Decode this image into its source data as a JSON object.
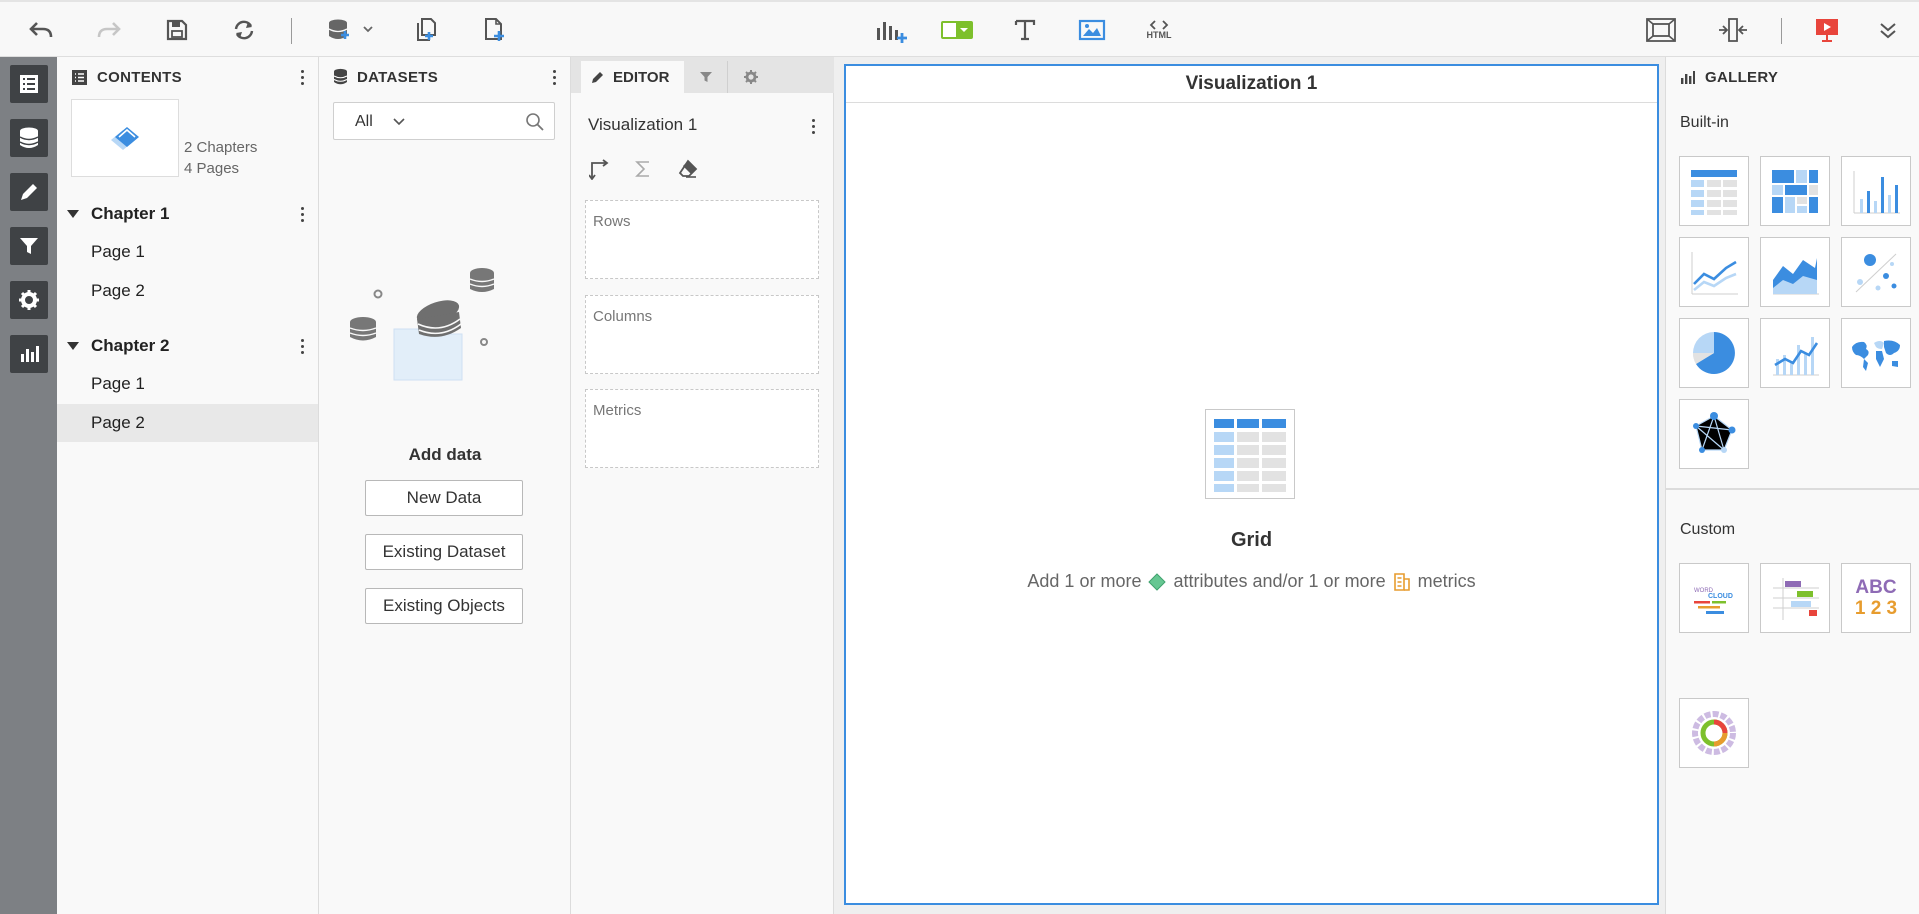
{
  "toolbar": {
    "undo": "undo-icon",
    "redo": "redo-icon",
    "save": "save-icon",
    "refresh": "refresh-icon",
    "add_data": "database-add-icon",
    "duplicate_chapter": "duplicate-page-icon",
    "new_page": "new-page-icon",
    "insert_visualization": "insert-chart-icon",
    "insert_filter": "filter-selector-icon",
    "insert_text": "text-icon",
    "insert_image": "image-icon",
    "insert_html": "HTML",
    "fit_page": "fit-page-icon",
    "responsive": "responsive-icon",
    "presentation": "presentation-icon",
    "more": "collapse-icon"
  },
  "contents": {
    "title": "CONTENTS",
    "summary": {
      "chapters": "2 Chapters",
      "pages": "4 Pages"
    },
    "chapters": [
      {
        "label": "Chapter 1",
        "pages": [
          "Page 1",
          "Page 2"
        ]
      },
      {
        "label": "Chapter 2",
        "pages": [
          "Page 1",
          "Page 2"
        ]
      }
    ]
  },
  "datasets": {
    "title": "DATASETS",
    "filter_value": "All",
    "add_data_label": "Add data",
    "buttons": {
      "new_data": "New Data",
      "existing_dataset": "Existing Dataset",
      "existing_objects": "Existing Objects"
    }
  },
  "editor": {
    "tab_label": "EDITOR",
    "viz_name": "Visualization 1",
    "zones": {
      "rows": "Rows",
      "columns": "Columns",
      "metrics": "Metrics"
    }
  },
  "canvas": {
    "viz_title": "Visualization 1",
    "placeholder_type": "Grid",
    "hint": {
      "part1": "Add 1 or more",
      "part2": "attributes and/or 1 or more",
      "part3": "metrics"
    }
  },
  "gallery": {
    "title": "GALLERY",
    "builtin_label": "Built-in",
    "custom_label": "Custom",
    "custom_abc": "ABC",
    "custom_123": "1 2 3",
    "wordcloud_text": "WORD CLOUD"
  },
  "colors": {
    "accent": "#3b8de0",
    "light_blue": "#b7d7f6",
    "iconbar": "#7d8084",
    "iconbtn": "#3f4245",
    "green": "#7dc02c",
    "red": "#e8453c"
  }
}
